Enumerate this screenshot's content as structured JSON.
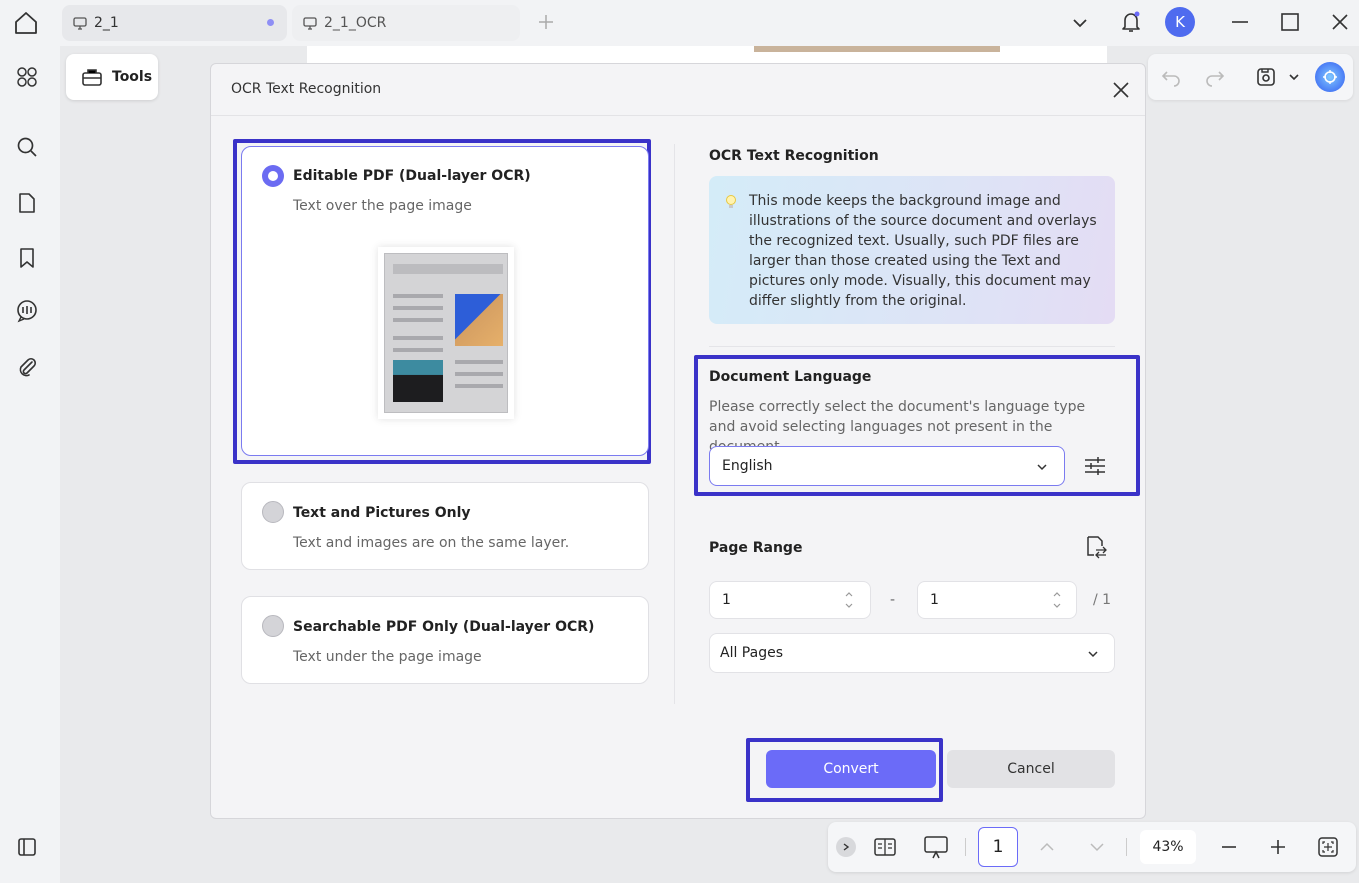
{
  "tabs": [
    {
      "label": "2_1",
      "active": true
    },
    {
      "label": "2_1_OCR",
      "active": false
    }
  ],
  "window": {
    "avatar_letter": "K"
  },
  "toolbar": {
    "tools_label": "Tools"
  },
  "dialog": {
    "title": "OCR Text Recognition",
    "options": [
      {
        "title": "Editable PDF (Dual-layer OCR)",
        "desc": "Text over the page image",
        "selected": true
      },
      {
        "title": "Text and Pictures Only",
        "desc": "Text and images are on the same layer.",
        "selected": false
      },
      {
        "title": "Searchable PDF Only (Dual-layer OCR)",
        "desc": "Text under the page image",
        "selected": false
      }
    ],
    "mode_section_title": "OCR Text Recognition",
    "mode_info": "This mode keeps the background image and illustrations of the source document and overlays the recognized text. Usually, such PDF files are larger than those created using the Text and pictures only mode. Visually, this document may differ slightly from the original.",
    "language": {
      "title": "Document Language",
      "desc": "Please correctly select the document's language type and avoid selecting languages not present in the document",
      "selected": "English"
    },
    "page_range": {
      "title": "Page Range",
      "from": "1",
      "dash": "-",
      "to": "1",
      "total": "/ 1",
      "mode": "All Pages"
    },
    "convert_label": "Convert",
    "cancel_label": "Cancel"
  },
  "bottom_bar": {
    "page_number": "1",
    "zoom": "43%"
  },
  "colors": {
    "accent": "#6b6bf8",
    "highlight": "#3a32c8"
  }
}
